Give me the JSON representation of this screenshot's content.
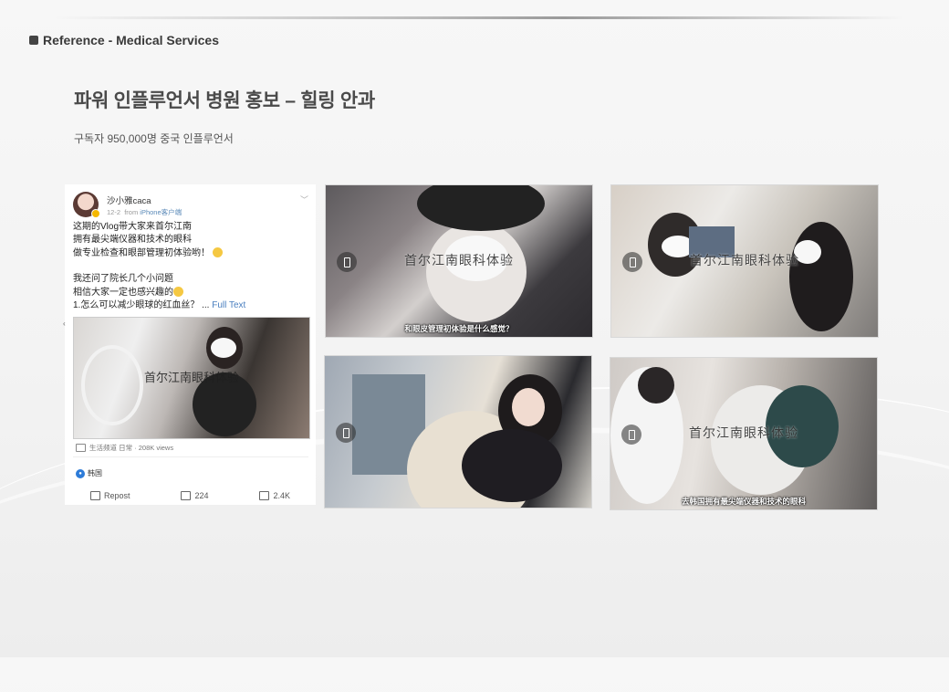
{
  "header": {
    "reference_label": "Reference - Medical Services",
    "title": "파워 인플루언서 병원 홍보 – 힐링 안과",
    "subtitle": "구독자 950,000명 중국 인플루언서"
  },
  "weibo_post": {
    "username": "沙小雅caca",
    "date": "12-2",
    "source_prefix": "from",
    "source": "iPhone客户端",
    "lines": [
      "这期的Vlog带大家来首尔江南",
      "拥有最尖端仪器和技术的眼科",
      "做专业检查和眼部管理初体验哟！",
      "",
      "我还问了院长几个小问题",
      "相信大家一定也感兴趣的",
      "1.怎么可以减少眼球的红血丝？ ..."
    ],
    "full_text_link": "Full Text",
    "image_caption": "首尔江南眼科体验",
    "views_text": "生活频道 日常 · 208K views",
    "location": "韩国",
    "actions": {
      "repost": "Repost",
      "comments": "224",
      "likes": "2.4K"
    }
  },
  "thumbnails": [
    {
      "caption": "首尔江南眼科体验",
      "subtitle": "和眼皮管理初体验是什么感觉？"
    },
    {
      "caption": "首尔江南眼科体验",
      "subtitle": ""
    },
    {
      "caption": "",
      "subtitle": ""
    },
    {
      "caption": "首尔江南眼科体验",
      "subtitle": "去韩国拥有最尖端仪器和技术的眼科"
    }
  ]
}
